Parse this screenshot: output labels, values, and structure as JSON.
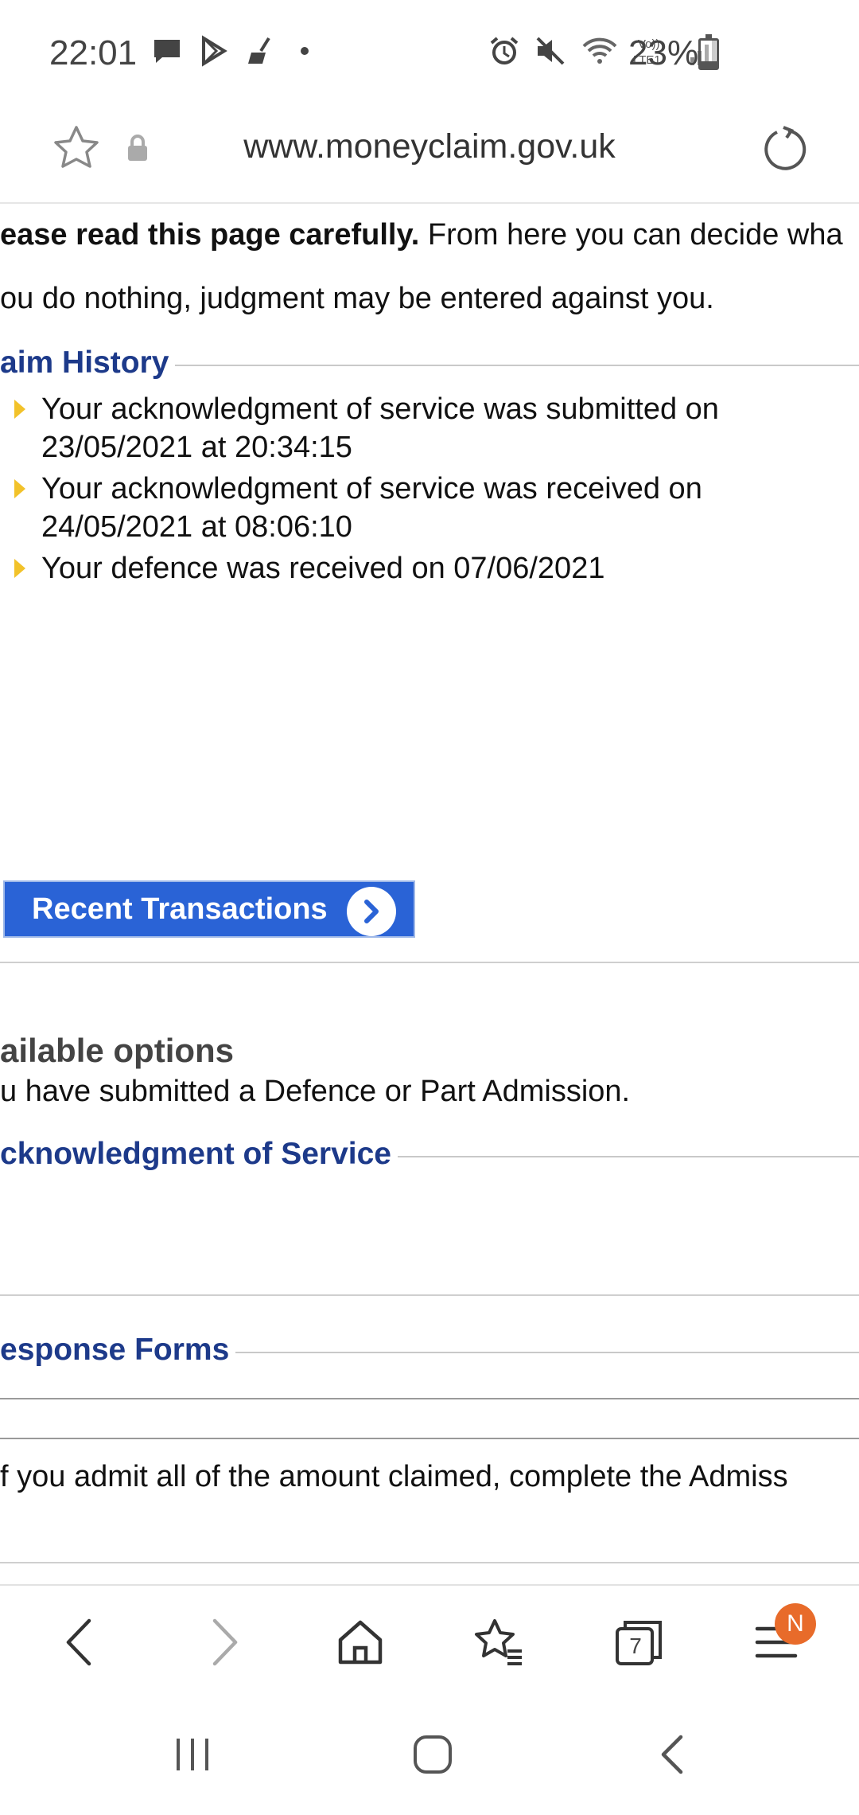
{
  "status_bar": {
    "time": "22:01",
    "battery": "23%",
    "battery_level": 0.23,
    "icons": [
      "message-icon",
      "play-store-icon",
      "broom-icon",
      "dot-icon",
      "alarm-icon",
      "mute-icon",
      "wifi-icon",
      "volte-icon",
      "signal-icon",
      "battery-icon"
    ],
    "volte_label": "Vo))",
    "lte_label": "LTE1"
  },
  "url_bar": {
    "url": "www.moneyclaim.gov.uk"
  },
  "page": {
    "intro_bold": "ease read this page carefully.",
    "intro_rest": " From here you can decide wha",
    "intro_line2": "ou do nothing, judgment may be entered against you.",
    "claim_history_heading": "aim History",
    "history": [
      {
        "line1": "Your acknowledgment of service was submitted on",
        "line2": "23/05/2021 at 20:34:15"
      },
      {
        "line1": "Your acknowledgment of service was received on",
        "line2": "24/05/2021 at 08:06:10"
      },
      {
        "line1": "Your defence was received on 07/06/2021",
        "line2": ""
      }
    ],
    "recent_transactions_label": "Recent Transactions",
    "options_title": "ailable options",
    "options_sub": "u have submitted a Defence or Part Admission.",
    "ack_heading": "cknowledgment of Service",
    "response_heading": "esponse Forms",
    "admit_text": "f you admit all of the amount claimed, complete the Admiss"
  },
  "browser_toolbar": {
    "tab_count": "7",
    "badge": "N"
  },
  "colors": {
    "link_blue": "#1d3a8a",
    "button_blue": "#2a63d6",
    "bullet_yellow": "#f2c22a",
    "badge_orange": "#e86b2a"
  }
}
